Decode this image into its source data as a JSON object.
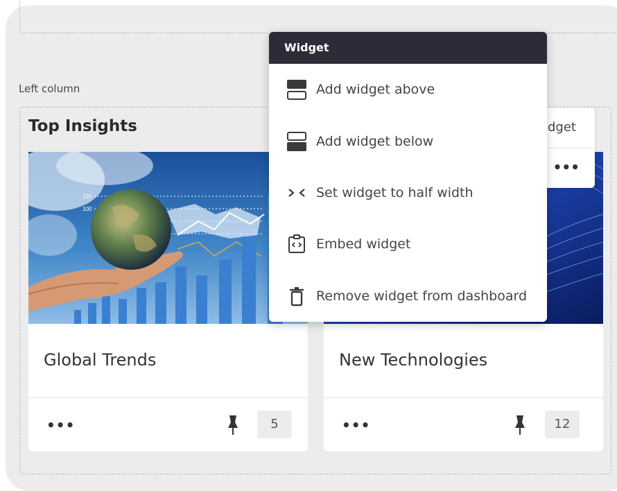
{
  "column": {
    "label": "Left column"
  },
  "section": {
    "title": "Top Insights"
  },
  "cards": [
    {
      "title": "Global Trends",
      "count": "5",
      "more": "•••"
    },
    {
      "title": "New Technologies",
      "count": "12",
      "more": "•••"
    }
  ],
  "behind_menu": {
    "partial_label": "dget",
    "more": "•••"
  },
  "widget_menu": {
    "header": "Widget",
    "items": [
      {
        "label": "Add widget above",
        "icon": "add-above-icon"
      },
      {
        "label": "Add widget below",
        "icon": "add-below-icon"
      },
      {
        "label": "Set widget to half width",
        "icon": "half-width-icon"
      },
      {
        "label": "Embed widget",
        "icon": "embed-icon"
      },
      {
        "label": "Remove widget from dashboard",
        "icon": "trash-icon"
      }
    ]
  },
  "colors": {
    "menu_header_bg": "#2b2c38",
    "frame_bg": "#ececec",
    "card_bg": "#ffffff"
  }
}
